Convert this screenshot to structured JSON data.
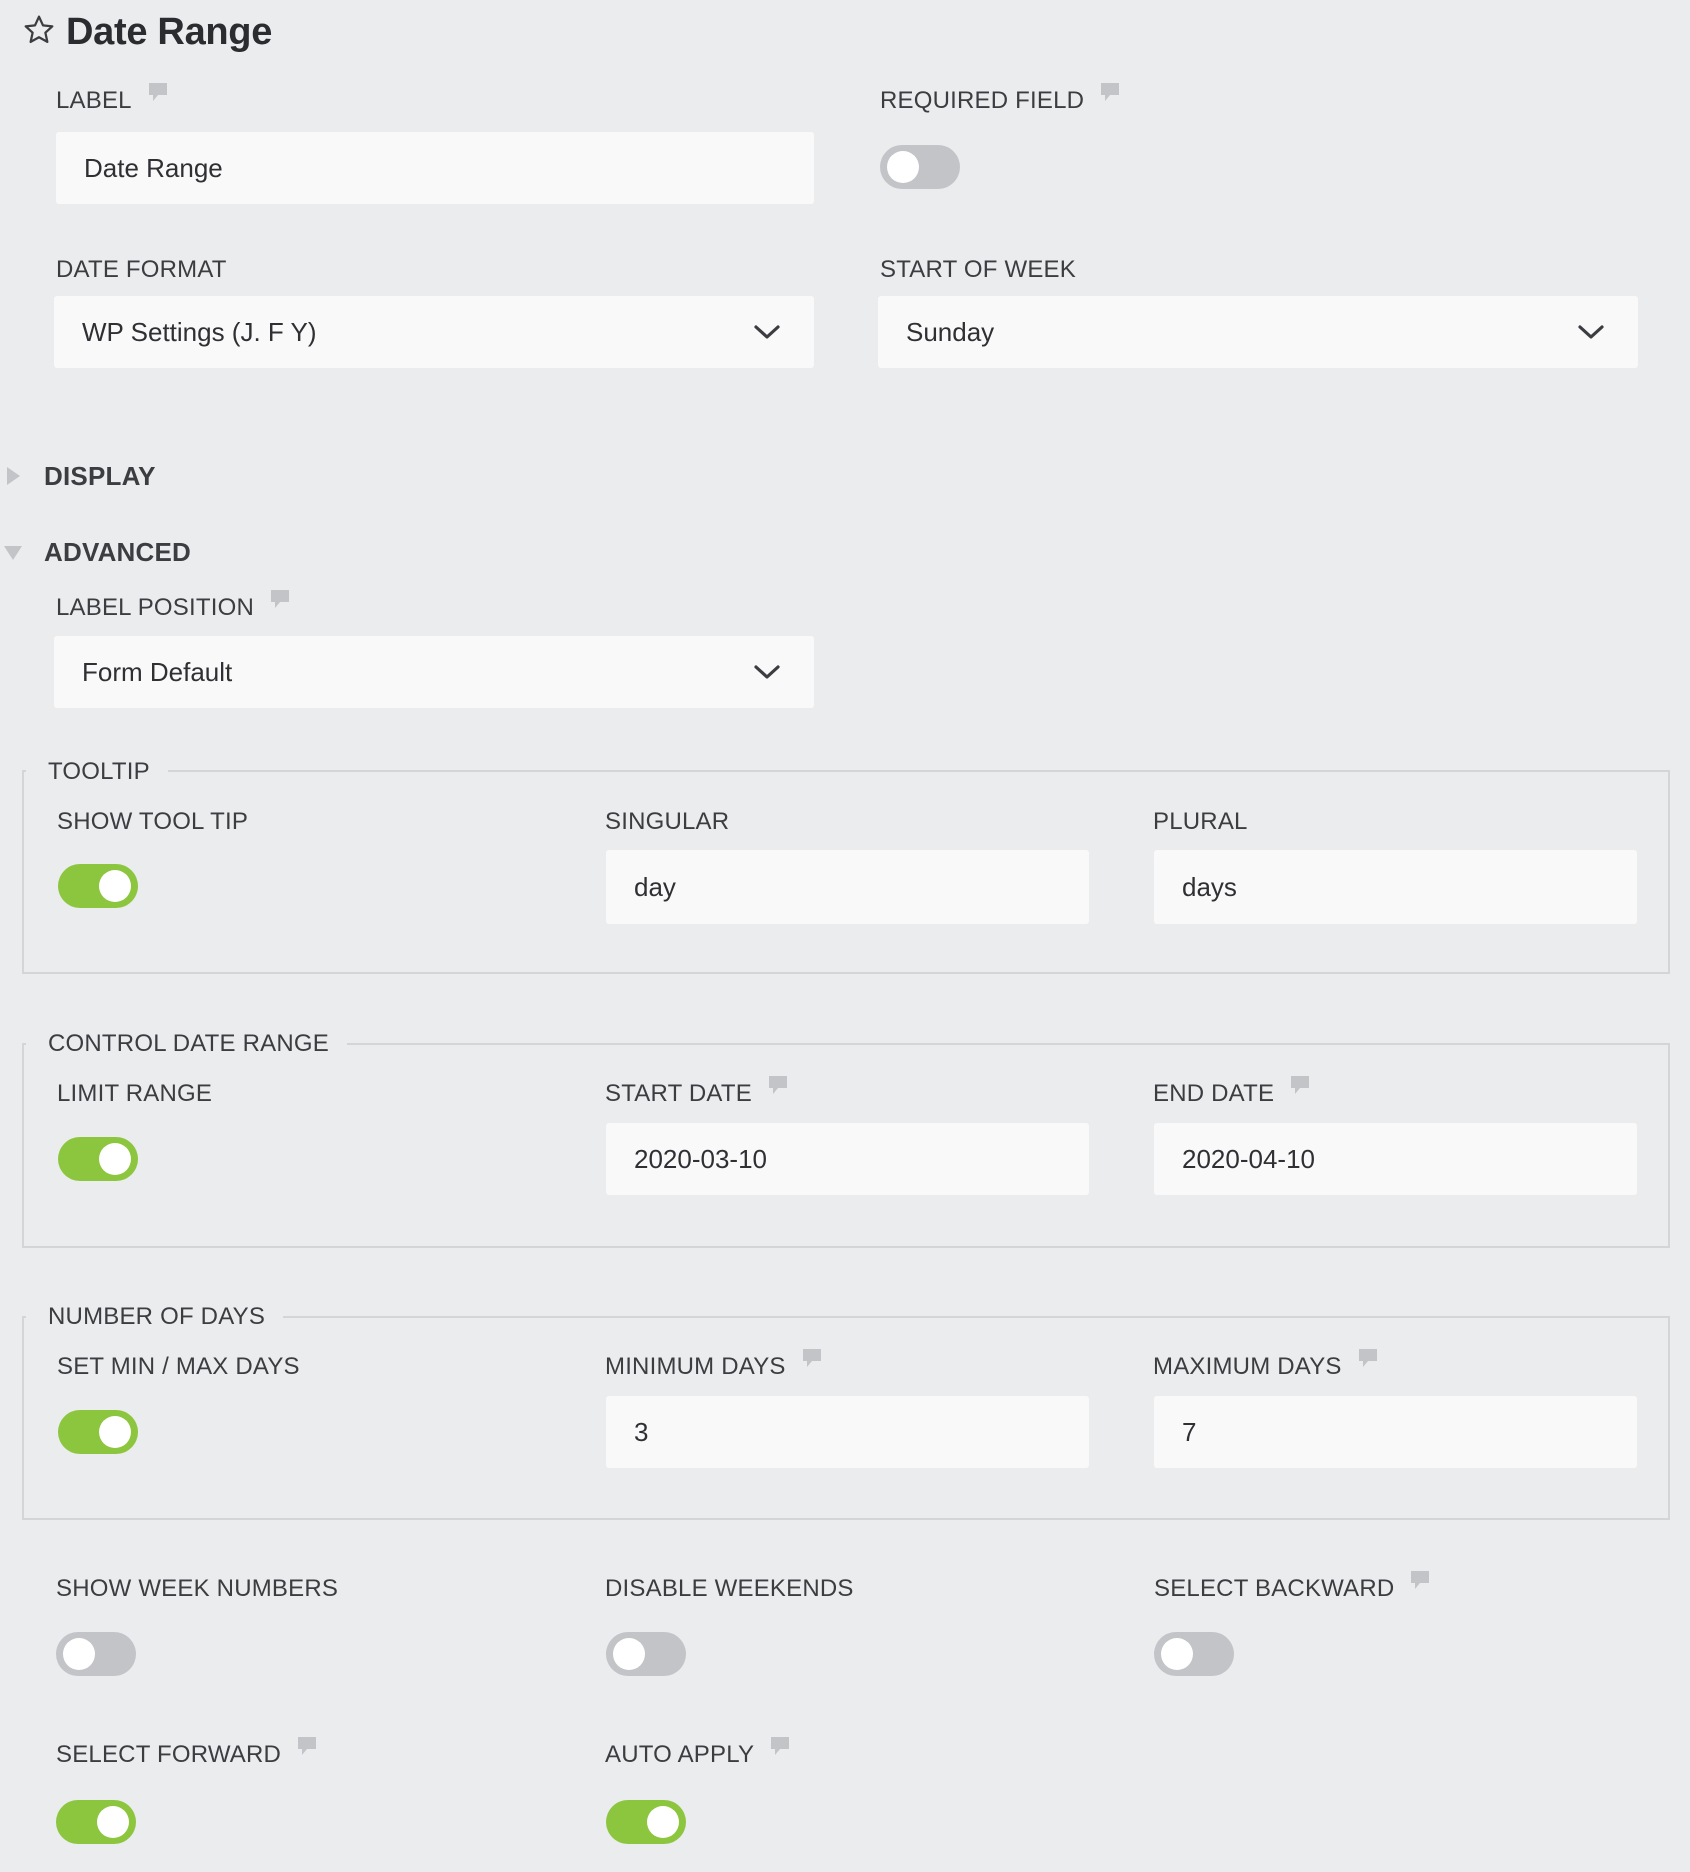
{
  "header": {
    "title": "Date Range",
    "icon": "star-outline-icon"
  },
  "basic": {
    "label": {
      "label": "LABEL",
      "value": "Date Range"
    },
    "required_field": {
      "label": "REQUIRED FIELD",
      "on": false
    },
    "date_format": {
      "label": "DATE FORMAT",
      "selected": "WP Settings (J. F Y)"
    },
    "start_of_week": {
      "label": "START OF WEEK",
      "selected": "Sunday"
    }
  },
  "sections": {
    "display": {
      "label": "DISPLAY",
      "expanded": false
    },
    "advanced": {
      "label": "ADVANCED",
      "expanded": true
    }
  },
  "advanced": {
    "label_position": {
      "label": "LABEL POSITION",
      "selected": "Form Default"
    },
    "tooltip": {
      "legend": "TOOLTIP",
      "show_tool_tip": {
        "label": "SHOW TOOL TIP",
        "on": true
      },
      "singular": {
        "label": "SINGULAR",
        "value": "day"
      },
      "plural": {
        "label": "PLURAL",
        "value": "days"
      }
    },
    "control_date_range": {
      "legend": "CONTROL DATE RANGE",
      "limit_range": {
        "label": "LIMIT RANGE",
        "on": true
      },
      "start_date": {
        "label": "START DATE",
        "value": "2020-03-10"
      },
      "end_date": {
        "label": "END DATE",
        "value": "2020-04-10"
      }
    },
    "number_of_days": {
      "legend": "NUMBER OF DAYS",
      "set_min_max_days": {
        "label": "SET MIN / MAX DAYS",
        "on": true
      },
      "minimum_days": {
        "label": "MINIMUM DAYS",
        "value": "3"
      },
      "maximum_days": {
        "label": "MAXIMUM DAYS",
        "value": "7"
      }
    },
    "show_week_numbers": {
      "label": "SHOW WEEK NUMBERS",
      "on": false
    },
    "disable_weekends": {
      "label": "DISABLE WEEKENDS",
      "on": false
    },
    "select_backward": {
      "label": "SELECT BACKWARD",
      "on": false
    },
    "select_forward": {
      "label": "SELECT FORWARD",
      "on": true
    },
    "auto_apply": {
      "label": "AUTO APPLY",
      "on": true
    }
  },
  "colors": {
    "background": "#ebecee",
    "field_background": "#f9f9f9",
    "toggle_on": "#8cc63f",
    "toggle_off": "#c3c4c7",
    "text": "#3c3d41",
    "help_icon": "#c3c4c7"
  }
}
